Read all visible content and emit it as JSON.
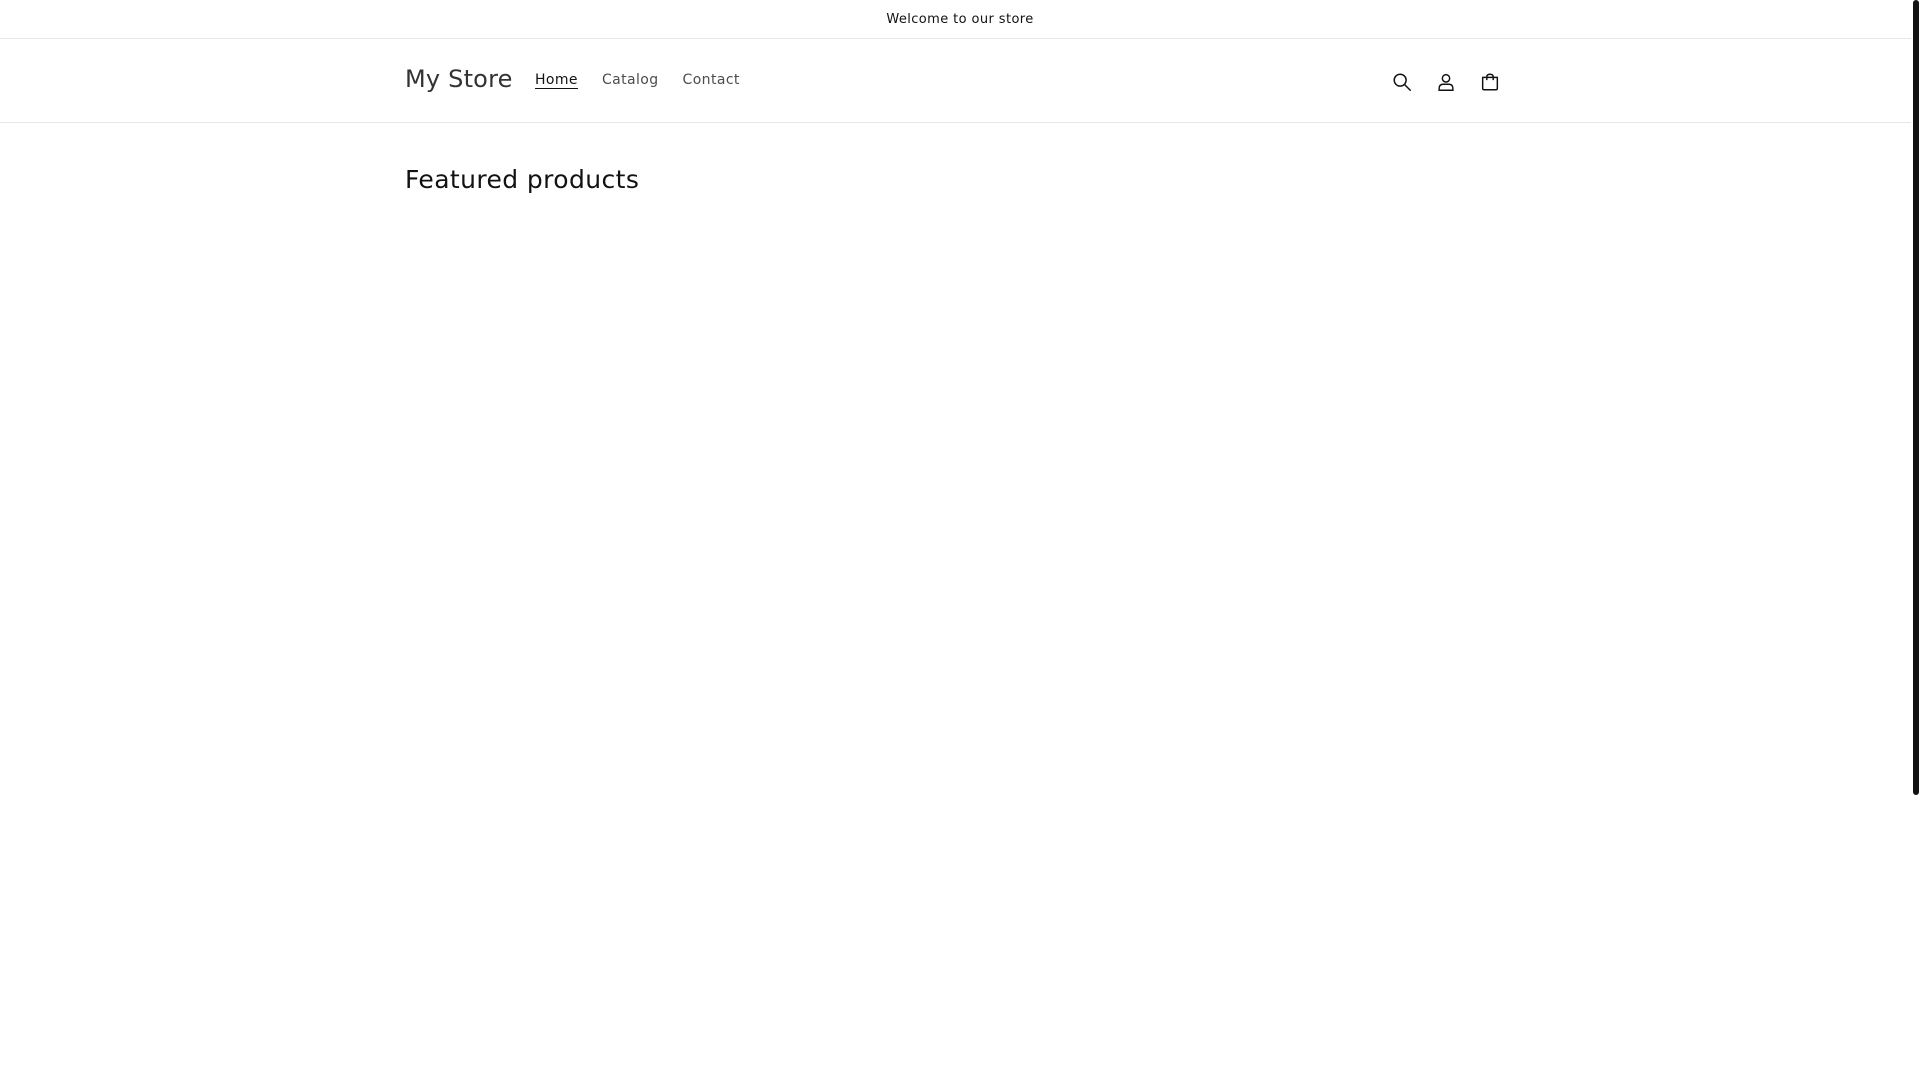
{
  "announcement": {
    "text": "Welcome to our store"
  },
  "header": {
    "logo": "My Store",
    "nav": [
      {
        "label": "Home",
        "active": true
      },
      {
        "label": "Catalog",
        "active": false
      },
      {
        "label": "Contact",
        "active": false
      }
    ],
    "icons": [
      "search-icon",
      "account-icon",
      "cart-icon"
    ]
  },
  "main": {
    "featured_title": "Featured products"
  },
  "colors": {
    "text": "#121212",
    "muted_text": "#4d4d4d",
    "border": "#e6e6e6",
    "background": "#ffffff"
  }
}
